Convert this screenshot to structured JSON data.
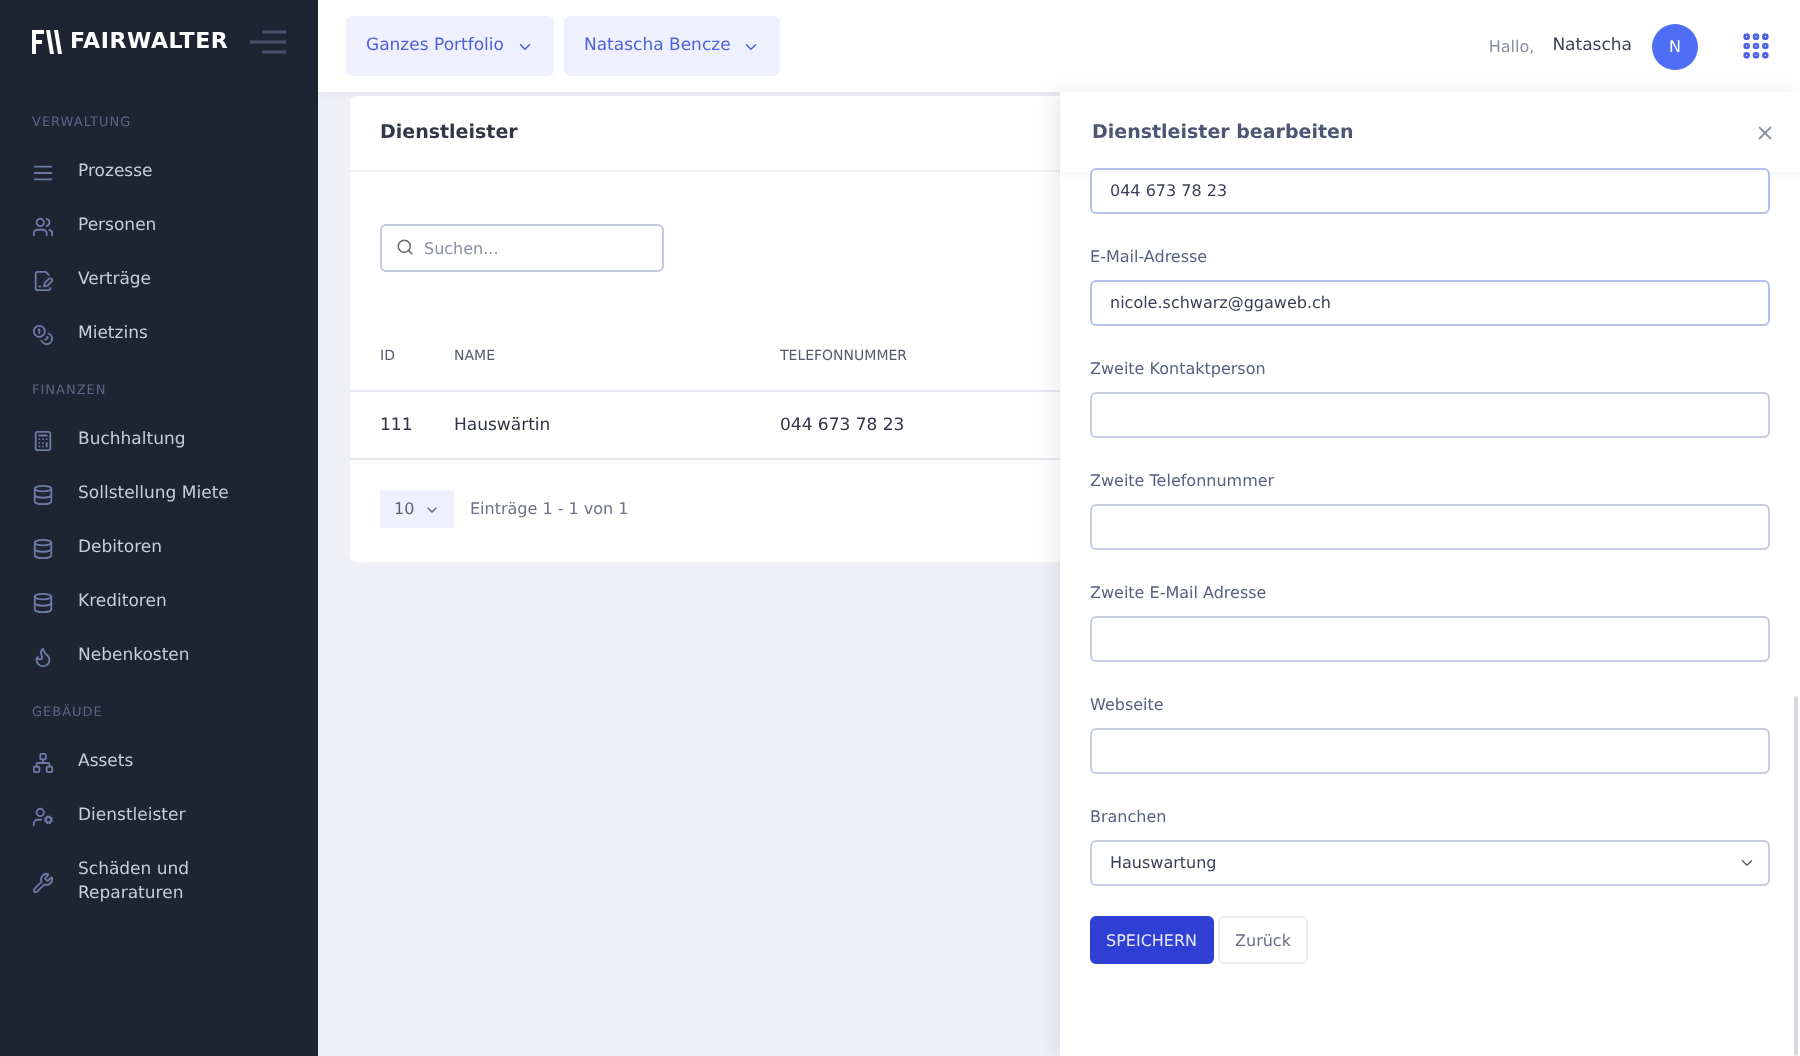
{
  "sidebar": {
    "brand": "FAIRWALTER",
    "sections": [
      {
        "title": "VERWALTUNG",
        "items": [
          {
            "label": "Prozesse",
            "selected": false
          },
          {
            "label": "Personen",
            "selected": false
          },
          {
            "label": "Verträge",
            "selected": false
          },
          {
            "label": "Mietzins",
            "selected": false
          }
        ]
      },
      {
        "title": "FINANZEN",
        "items": [
          {
            "label": "Buchhaltung",
            "selected": false
          },
          {
            "label": "Sollstellung Miete",
            "selected": false
          },
          {
            "label": "Debitoren",
            "selected": false
          },
          {
            "label": "Kreditoren",
            "selected": false
          },
          {
            "label": "Nebenkosten",
            "selected": false
          }
        ]
      },
      {
        "title": "GEBÄUDE",
        "items": [
          {
            "label": "Assets",
            "selected": false
          },
          {
            "label": "Dienstleister",
            "selected": false
          },
          {
            "label": "Schäden und Reparaturen",
            "selected": false
          }
        ]
      }
    ]
  },
  "topbar": {
    "filters": [
      "Ganzes Portfolio",
      "Natascha Bencze"
    ],
    "greeting": "Hallo,",
    "user": "Natascha",
    "avatar": "N"
  },
  "card": {
    "title": "Dienstleister",
    "search": {
      "placeholder": "Suchen..."
    },
    "table": {
      "columns": [
        "ID",
        "NAME",
        "TELEFONNUMMER"
      ],
      "rows": [
        [
          "111",
          "Hauswärtin",
          "044 673 78 23"
        ]
      ]
    },
    "page_size": "10",
    "page_info": "Einträge 1 - 1 von 1"
  },
  "panel": {
    "title": "Dienstleister bearbeiten",
    "fields": [
      {
        "kind": "input",
        "value": "044 673 78 23"
      },
      {
        "kind": "input",
        "label": "E-Mail-Adresse",
        "value": "nicole.schwarz@ggaweb.ch"
      },
      {
        "kind": "input",
        "label": "Zweite Kontaktperson"
      },
      {
        "kind": "input",
        "label": "Zweite Telefonnummer"
      },
      {
        "kind": "input",
        "label": "Zweite E-Mail Adresse"
      },
      {
        "kind": "input",
        "label": "Webseite"
      },
      {
        "kind": "select",
        "label": "Branchen",
        "value": "Hauswartung"
      }
    ],
    "buttons": [
      {
        "label": "SPEICHERN",
        "kind": "primary"
      },
      {
        "label": "Zurück",
        "kind": "secondary"
      }
    ]
  }
}
